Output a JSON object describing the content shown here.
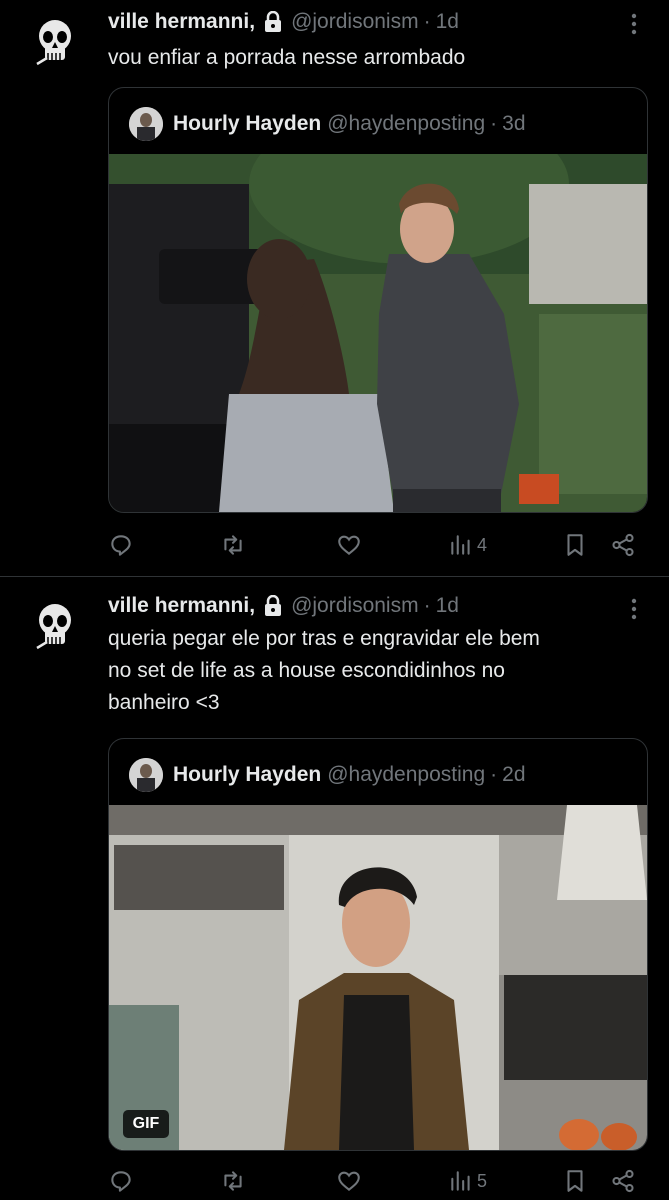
{
  "tweets": [
    {
      "author_name": "ville hermanni",
      "comma": ",",
      "handle": "@jordisonism",
      "separator": "·",
      "time": "1d",
      "text": "vou enfiar a porrada nesse arrombado",
      "quote": {
        "name": "Hourly Hayden",
        "handle": "@haydenposting",
        "separator": "·",
        "time": "3d"
      },
      "actions": {
        "views": "4"
      }
    },
    {
      "author_name": "ville hermanni",
      "comma": ",",
      "handle": "@jordisonism",
      "separator": "·",
      "time": "1d",
      "text": "queria pegar ele por tras e engravidar ele bem\nno set de life as a house escondidinhos no\nbanheiro <3",
      "quote": {
        "name": "Hourly Hayden",
        "handle": "@haydenposting",
        "separator": "·",
        "time": "2d",
        "badge": "GIF"
      },
      "actions": {
        "views": "5"
      }
    }
  ],
  "icons": {
    "avatar": "skull-icon",
    "lock": "lock-icon",
    "more": "more-icon",
    "reply": "reply-icon",
    "retweet": "retweet-icon",
    "like": "heart-icon",
    "views": "views-icon",
    "bookmark": "bookmark-icon",
    "share": "share-icon"
  },
  "colors": {
    "background": "#000000",
    "text": "#e7e9ea",
    "muted": "#71767b",
    "border": "#2f3336"
  }
}
